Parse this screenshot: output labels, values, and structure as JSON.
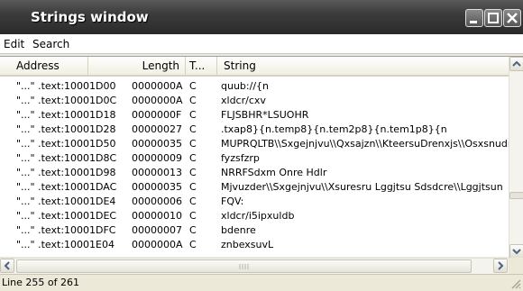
{
  "window": {
    "title": "Strings window"
  },
  "menu": [
    "Edit",
    "Search"
  ],
  "columns": [
    "Address",
    "Length",
    "T...",
    "String"
  ],
  "rows": [
    {
      "prefix": "\"...\"",
      "address": ".text:10001D00",
      "length": "0000000A",
      "type": "C",
      "string": "quub://{n"
    },
    {
      "prefix": "\"...\"",
      "address": ".text:10001D0C",
      "length": "0000000A",
      "type": "C",
      "string": "xldcr/cxv"
    },
    {
      "prefix": "\"...\"",
      "address": ".text:10001D18",
      "length": "0000000F",
      "type": "C",
      "string": "FLJSBHR*LSUOHR"
    },
    {
      "prefix": "\"...\"",
      "address": ".text:10001D28",
      "length": "00000027",
      "type": "C",
      "string": ".txap8}{n.temp8}{n.tem2p8}{n.tem1p8}{n"
    },
    {
      "prefix": "\"...\"",
      "address": ".text:10001D50",
      "length": "00000035",
      "type": "C",
      "string": "MUPRQLTB\\\\Sxgejnjvu\\\\Qxsajzn\\\\KteersuDrenxjs\\\\Osxsnudmm\\"
    },
    {
      "prefix": "\"...\"",
      "address": ".text:10001D8C",
      "length": "00000009",
      "type": "C",
      "string": "fyzsfzrp"
    },
    {
      "prefix": "\"...\"",
      "address": ".text:10001D98",
      "length": "00000013",
      "type": "C",
      "string": "NRRFSdxm Onre Hdlr"
    },
    {
      "prefix": "\"...\"",
      "address": ".text:10001DAC",
      "length": "00000035",
      "type": "C",
      "string": "Mjvuzder\\\\Sxgejnjvu\\\\Xsuresru Lggjtsu Sdsdcre\\\\Lggjtsun"
    },
    {
      "prefix": "\"...\"",
      "address": ".text:10001DE4",
      "length": "00000006",
      "type": "C",
      "string": "FQV:"
    },
    {
      "prefix": "\"...\"",
      "address": ".text:10001DEC",
      "length": "00000010",
      "type": "C",
      "string": "xldcr/i5ipxuldb"
    },
    {
      "prefix": "\"...\"",
      "address": ".text:10001DFC",
      "length": "00000007",
      "type": "C",
      "string": "bdenre"
    },
    {
      "prefix": "\"...\"",
      "address": ".text:10001E04",
      "length": "0000000A",
      "type": "C",
      "string": "znbexsuvL"
    }
  ],
  "status": "Line 255 of 261"
}
